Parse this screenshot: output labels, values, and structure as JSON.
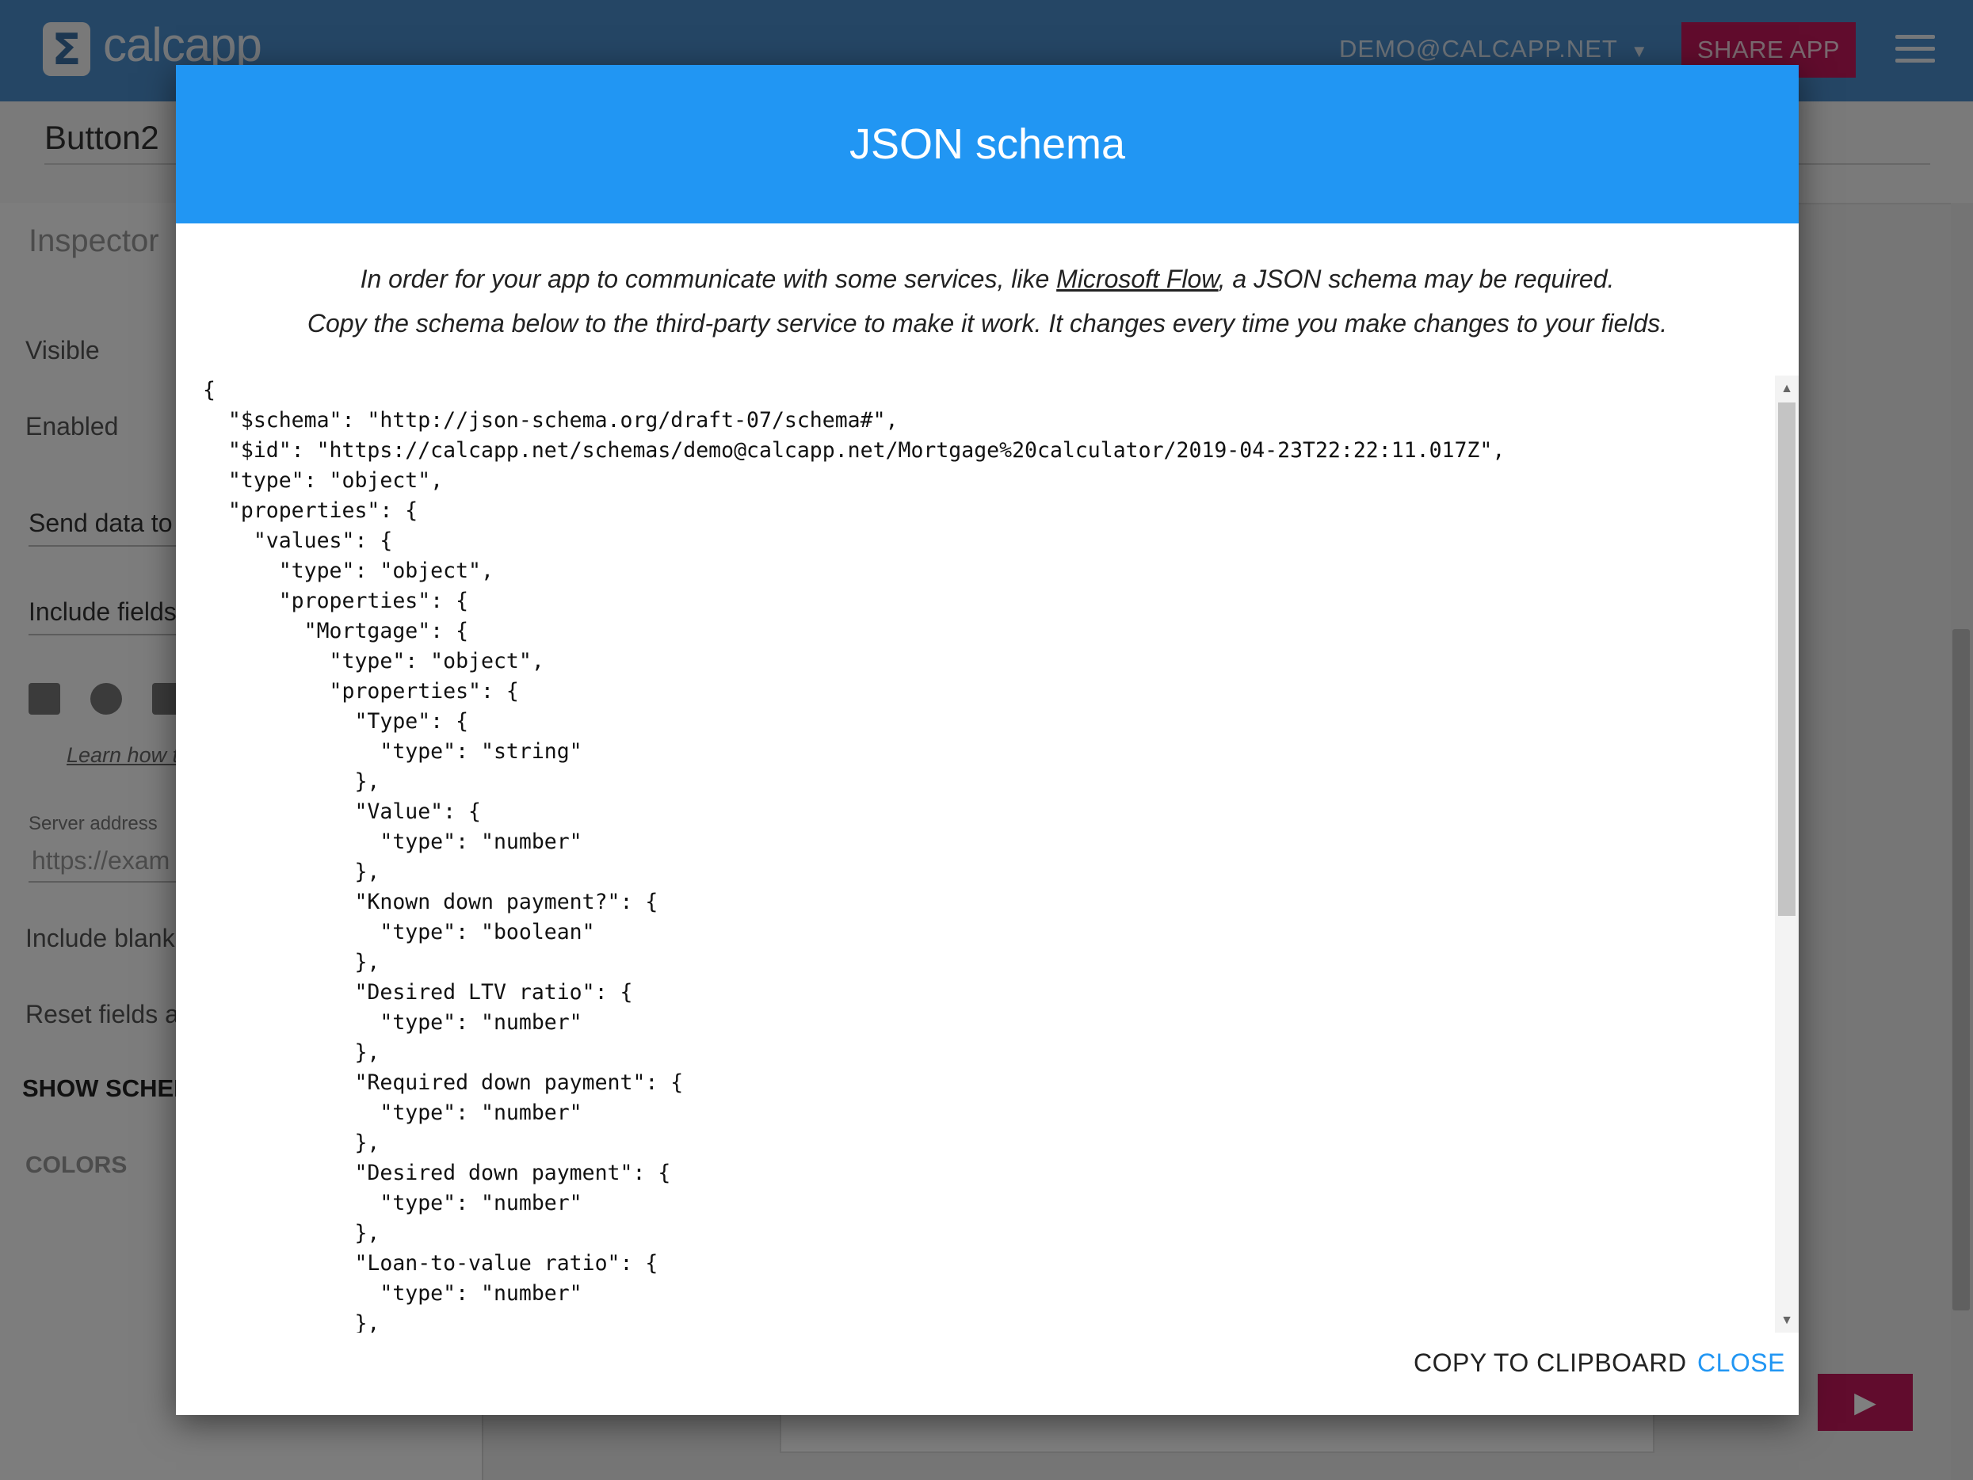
{
  "app": {
    "logo_symbol": "Σ",
    "logo_text": "calcapp",
    "user_email": "DEMO@CALCAPP.NET",
    "share_label": "SHARE APP",
    "element_name": "Button2",
    "accent_color": "#c2185b",
    "header_color": "#2196f3"
  },
  "inspector": {
    "heading": "Inspector",
    "visible_label": "Visible",
    "enabled_label": "Enabled",
    "send_data_label": "Send data to",
    "include_fields_label": "Include fields",
    "learn_how_label": "Learn how t",
    "server_address_label": "Server address",
    "server_address_placeholder": "https://exam",
    "include_blank_label": "Include blank",
    "reset_fields_label": "Reset fields a",
    "show_schema_label": "SHOW SCHEN",
    "colors_label": "COLORS"
  },
  "dialog": {
    "title": "JSON schema",
    "intro_part1": "In order for your app to communicate with some services, like ",
    "intro_link": "Microsoft Flow",
    "intro_part2": ", a JSON schema may be required.",
    "intro_line2": "Copy the schema below to the third-party service to make it work. It changes every time you make changes to your fields.",
    "schema_text": "{\n  \"$schema\": \"http://json-schema.org/draft-07/schema#\",\n  \"$id\": \"https://calcapp.net/schemas/demo@calcapp.net/Mortgage%20calculator/2019-04-23T22:22:11.017Z\",\n  \"type\": \"object\",\n  \"properties\": {\n    \"values\": {\n      \"type\": \"object\",\n      \"properties\": {\n        \"Mortgage\": {\n          \"type\": \"object\",\n          \"properties\": {\n            \"Type\": {\n              \"type\": \"string\"\n            },\n            \"Value\": {\n              \"type\": \"number\"\n            },\n            \"Known down payment?\": {\n              \"type\": \"boolean\"\n            },\n            \"Desired LTV ratio\": {\n              \"type\": \"number\"\n            },\n            \"Required down payment\": {\n              \"type\": \"number\"\n            },\n            \"Desired down payment\": {\n              \"type\": \"number\"\n            },\n            \"Loan-to-value ratio\": {\n              \"type\": \"number\"\n            },",
    "copy_label": "COPY TO CLIPBOARD",
    "close_label": "CLOSE"
  }
}
